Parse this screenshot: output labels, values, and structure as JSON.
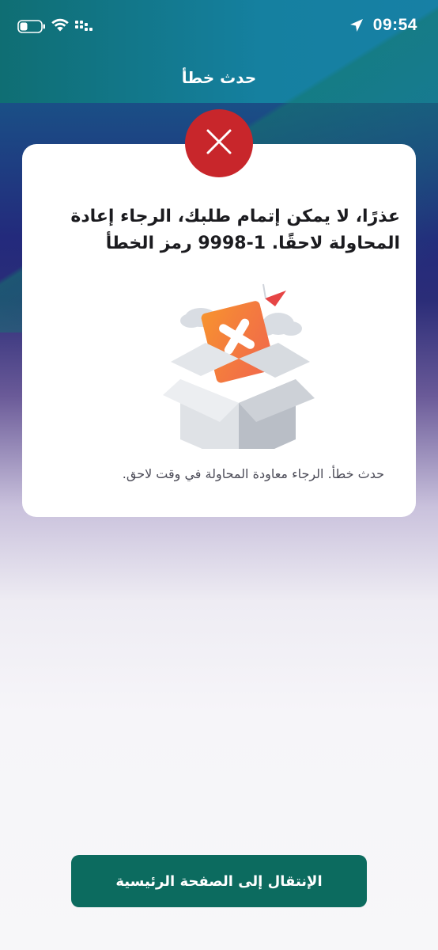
{
  "status_bar": {
    "time": "09:54",
    "icons": [
      "battery-icon",
      "wifi-icon",
      "signal-icon",
      "location-arrow-icon"
    ]
  },
  "header": {
    "title": "حدث خطأ"
  },
  "error_card": {
    "status_icon": "close-icon",
    "heading": "عذرًا، لا يمكن إتمام طلبك، الرجاء إعادة المحاولة لاحقًا. 1-9998 رمز الخطأ",
    "illustration": "open-box-with-error-card",
    "message": "حدث خطأ. الرجاء معاودة المحاولة في وقت لاحق."
  },
  "home_button": {
    "label": "الإنتقال إلى الصفحة الرئيسية"
  },
  "colors": {
    "error_red": "#c8262b",
    "primary_green": "#0c6b5f",
    "header_teal": "#13727e",
    "background_indigo": "#242b7d"
  }
}
